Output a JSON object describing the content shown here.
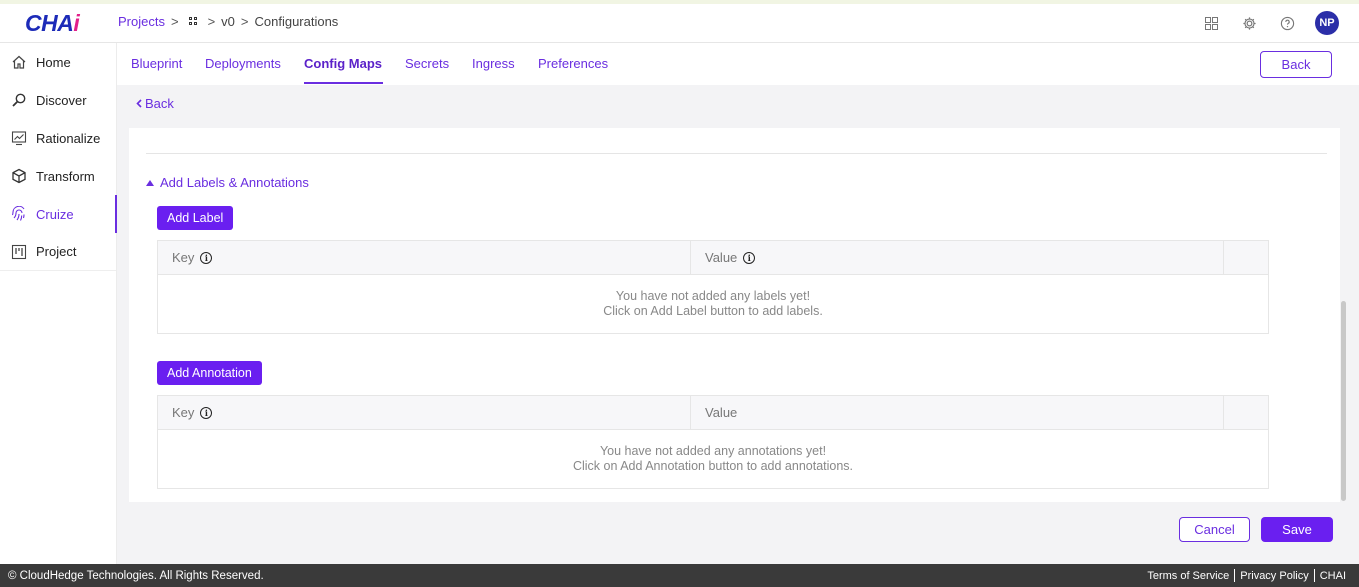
{
  "header": {
    "logo_main": "CHA",
    "logo_accent": "i",
    "breadcrumb": {
      "projects": "Projects",
      "version": "v0",
      "current": "Configurations"
    },
    "user_initials": "NP",
    "icons": [
      "apps-grid-icon",
      "gear-icon",
      "help-icon"
    ]
  },
  "sidebar": {
    "items": [
      {
        "label": "Home",
        "icon": "home-icon"
      },
      {
        "label": "Discover",
        "icon": "discover-icon"
      },
      {
        "label": "Rationalize",
        "icon": "chart-icon"
      },
      {
        "label": "Transform",
        "icon": "cube-icon"
      },
      {
        "label": "Cruize",
        "icon": "fingerprint-icon",
        "active": true
      },
      {
        "label": "Project",
        "icon": "board-icon"
      }
    ]
  },
  "tabs": {
    "items": [
      "Blueprint",
      "Deployments",
      "Config Maps",
      "Secrets",
      "Ingress",
      "Preferences"
    ],
    "active": "Config Maps",
    "back_button": "Back"
  },
  "back_link": "Back",
  "section": {
    "toggle_label": "Add Labels & Annotations",
    "labels": {
      "add_button": "Add Label",
      "col_key": "Key",
      "col_value": "Value",
      "empty_line1": "You have not added any labels yet!",
      "empty_line2": "Click on Add Label button to add labels."
    },
    "annotations": {
      "add_button": "Add Annotation",
      "col_key": "Key",
      "col_value": "Value",
      "empty_line1": "You have not added any annotations yet!",
      "empty_line2": "Click on Add Annotation button to add annotations."
    }
  },
  "actions": {
    "cancel": "Cancel",
    "save": "Save"
  },
  "footer": {
    "copyright": "© CloudHedge Technologies. All Rights Reserved.",
    "terms": "Terms of Service",
    "privacy": "Privacy Policy",
    "brand": "CHAI"
  },
  "colors": {
    "accent": "#6a2ee0",
    "button": "#6a1ff0",
    "logo": "#1d2bb8",
    "footer": "#3a3a3a"
  }
}
